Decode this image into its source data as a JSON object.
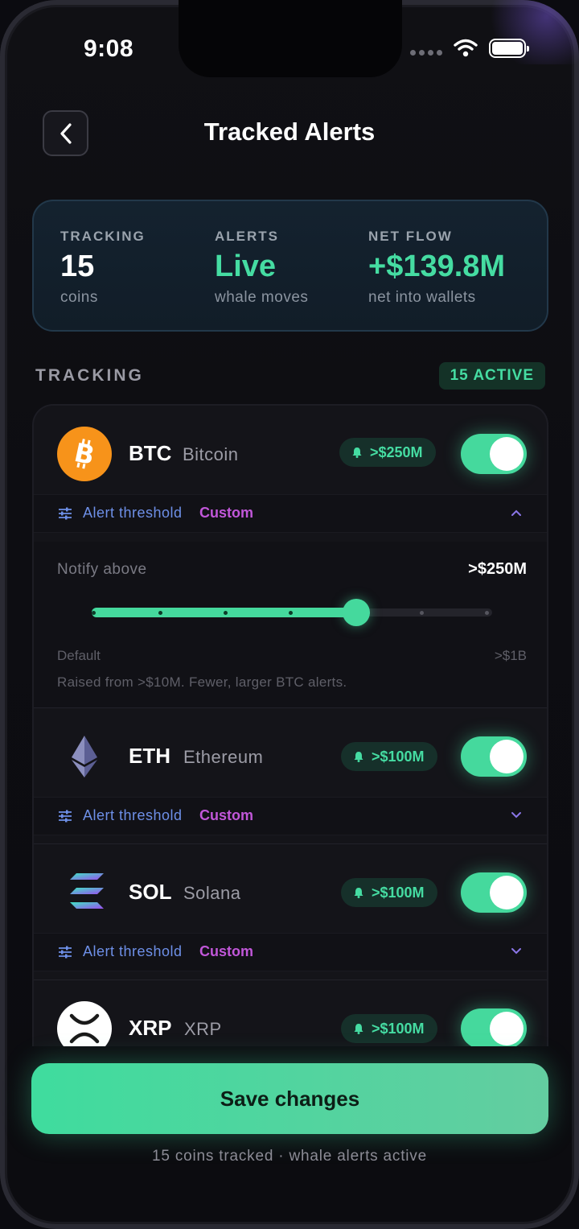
{
  "status_bar": {
    "time": "9:08"
  },
  "header": {
    "title": "Tracked Alerts"
  },
  "summary": [
    {
      "label": "TRACKING",
      "value": "15",
      "sub": "coins"
    },
    {
      "label": "ALERTS",
      "value": "Live",
      "sub": "whale moves"
    },
    {
      "label": "NET FLOW",
      "value": "+$139.8M",
      "sub": "net into wallets"
    }
  ],
  "section": {
    "heading": "TRACKING",
    "badge": "15 ACTIVE"
  },
  "coins": [
    {
      "symbol": "BTC",
      "name": "Bitcoin",
      "threshold": ">$250M",
      "enabled": true,
      "threshold_label": "Alert threshold",
      "mode": "Custom",
      "expanded": true
    },
    {
      "symbol": "ETH",
      "name": "Ethereum",
      "threshold": ">$100M",
      "enabled": true,
      "threshold_label": "Alert threshold",
      "mode": "Custom",
      "expanded": false
    },
    {
      "symbol": "SOL",
      "name": "Solana",
      "threshold": ">$100M",
      "enabled": true,
      "threshold_label": "Alert threshold",
      "mode": "Custom",
      "expanded": false
    },
    {
      "symbol": "XRP",
      "name": "XRP",
      "threshold": ">$100M",
      "enabled": true
    }
  ],
  "btc_panel": {
    "notify_label": "Notify above",
    "notify_value": ">$250M",
    "slider_level": 0.66,
    "default_label": "Default",
    "max_label": ">$1B",
    "note": "Raised from >$10M. Fewer, larger BTC alerts."
  },
  "footer": {
    "save_label": "Save changes",
    "note": "15 coins tracked · whale alerts active"
  },
  "colors": {
    "accent": "#45dca2",
    "custom": "#c157d9",
    "link": "#6e90e8",
    "btc": "#f7931a"
  }
}
